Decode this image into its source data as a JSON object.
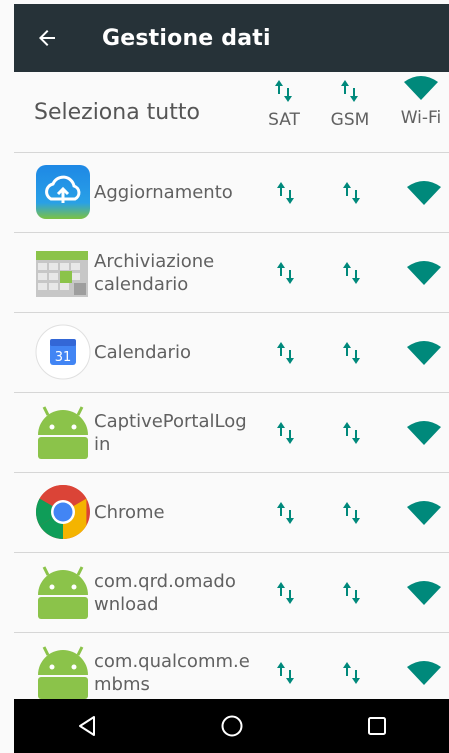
{
  "app_bar": {
    "title": "Gestione dati",
    "back_icon": "arrow-back-icon"
  },
  "header": {
    "select_all_label": "Seleziona tutto",
    "columns": [
      {
        "label": "SAT",
        "icon": "data-transfer-icon"
      },
      {
        "label": "GSM",
        "icon": "data-transfer-icon"
      },
      {
        "label": "Wi-Fi",
        "icon": "wifi-icon"
      }
    ]
  },
  "apps": [
    {
      "name": "Aggiornamento",
      "icon": "update-cloud-icon"
    },
    {
      "name": "Archiviazione calendario",
      "icon": "calendar-storage-icon"
    },
    {
      "name": "Calendario",
      "icon": "calendar-icon"
    },
    {
      "name": "CaptivePortalLog in",
      "icon": "android-icon"
    },
    {
      "name": "Chrome",
      "icon": "chrome-icon"
    },
    {
      "name": "com.qrd.omado wnload",
      "icon": "android-icon"
    },
    {
      "name": "com.qualcomm.e mbms",
      "icon": "android-icon"
    }
  ],
  "calendar_icon_text": "31",
  "nav": {
    "back": "back-triangle-icon",
    "home": "home-circle-icon",
    "recents": "recents-square-icon"
  },
  "colors": {
    "accent": "#00897b",
    "app_bar": "#263238",
    "nav_bar": "#000000"
  }
}
